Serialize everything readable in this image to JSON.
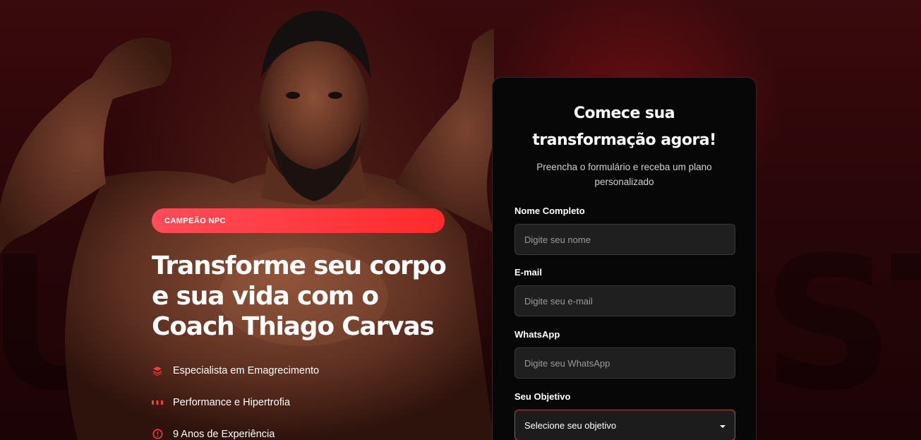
{
  "hero": {
    "badge": "CAMPEÃO NPC",
    "headline_line1": "Transforme seu corpo",
    "headline_line2": "e sua vida com o",
    "headline_line3": "Coach Thiago Carvas",
    "features": [
      {
        "label": "Especialista em Emagrecimento",
        "icon": "layers-icon"
      },
      {
        "label": "Performance e Hipertrofia",
        "icon": "dumbbell-icon"
      },
      {
        "label": "9 Anos de Experiência",
        "icon": "alert-circle-icon"
      }
    ]
  },
  "form": {
    "title_line1": "Comece sua",
    "title_line2": "transformação agora!",
    "subtitle_line1": "Preencha o formulário e receba um plano",
    "subtitle_line2": "personalizado",
    "name_label": "Nome Completo",
    "name_placeholder": "Digite seu nome",
    "email_label": "E-mail",
    "email_placeholder": "Digite seu e-mail",
    "whatsapp_label": "WhatsApp",
    "whatsapp_placeholder": "Digite seu WhatsApp",
    "goal_label": "Seu Objetivo",
    "goal_selected": "Selecione seu objetivo"
  },
  "colors": {
    "accent": "#ff3a3f",
    "card_bg": "#070707",
    "input_bg": "#1f1f1f"
  }
}
